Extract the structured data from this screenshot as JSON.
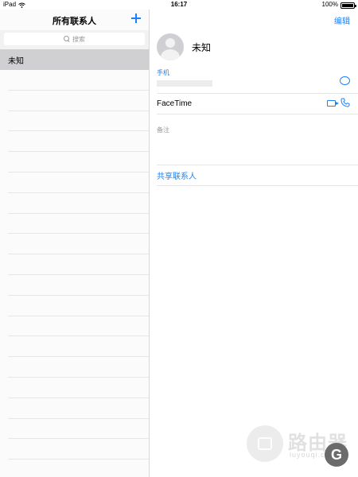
{
  "status_bar": {
    "device": "iPad",
    "time": "16:17",
    "battery_text": "100%",
    "battery_level": 1.0
  },
  "left_panel": {
    "title": "所有联系人",
    "search_placeholder": "搜索",
    "selected_contact": "未知",
    "empty_row_count": 20
  },
  "right_panel": {
    "edit_label": "编辑",
    "contact_name": "未知",
    "phone_label": "手机",
    "facetime_label": "FaceTime",
    "notes_label": "备注",
    "share_label": "共享联系人"
  },
  "watermark": {
    "main": "路由器",
    "sub": "luyouqi.com",
    "badge": "G"
  },
  "colors": {
    "accent": "#1a82fb",
    "selected_row": "#d0d0d2",
    "separator": "#e6e6e6"
  }
}
